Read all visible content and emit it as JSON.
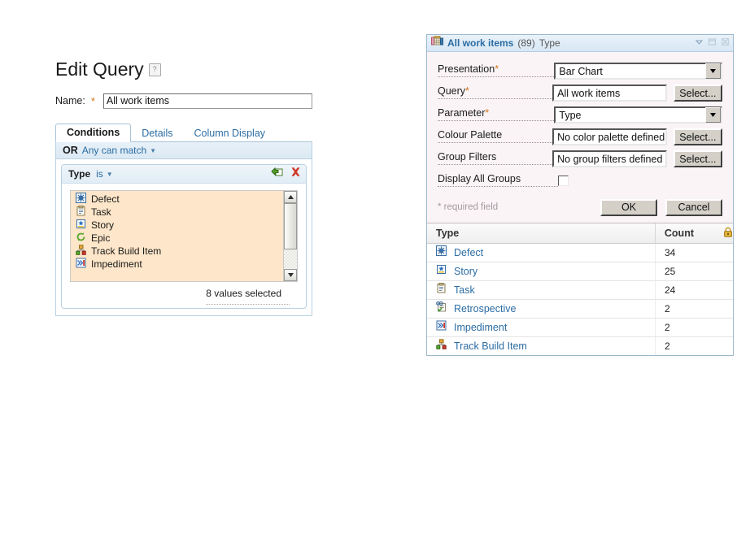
{
  "edit_query": {
    "title": "Edit Query",
    "help_icon": "help-icon",
    "name_label": "Name:",
    "required_mark": "*",
    "name_value": "All work items",
    "name_placeholder": "",
    "tabs": [
      {
        "label": "Conditions",
        "active": true
      },
      {
        "label": "Details",
        "active": false
      },
      {
        "label": "Column Display",
        "active": false
      }
    ],
    "match_bar": {
      "operator": "OR",
      "text": "Any can match"
    },
    "condition": {
      "field": "Type",
      "operator": "is",
      "copy_icon": "copy-condition-icon",
      "delete_icon": "delete-condition-icon",
      "values": [
        {
          "label": "Defect",
          "icon": "defect-icon"
        },
        {
          "label": "Task",
          "icon": "task-icon"
        },
        {
          "label": "Story",
          "icon": "story-icon"
        },
        {
          "label": "Epic",
          "icon": "epic-icon"
        },
        {
          "label": "Track Build Item",
          "icon": "track-build-item-icon"
        },
        {
          "label": "Impediment",
          "icon": "impediment-icon"
        }
      ],
      "selected_note": "8 values selected"
    }
  },
  "dialog": {
    "icon": "bar-chart-report-icon",
    "title": "All work items",
    "count_label": "(89)",
    "param_label": "Type",
    "controls": {
      "collapse": "chevron-down-icon",
      "restore": "restore-icon",
      "maximize": "maximize-icon"
    },
    "fields": {
      "presentation": {
        "label": "Presentation",
        "required": "*",
        "value": "Bar Chart"
      },
      "query": {
        "label": "Query",
        "required": "*",
        "value": "All work items",
        "button": "Select..."
      },
      "parameter": {
        "label": "Parameter",
        "required": "*",
        "value": "Type"
      },
      "colour_palette": {
        "label": "Colour Palette",
        "required": "",
        "value": "No color palette defined",
        "button": "Select..."
      },
      "group_filters": {
        "label": "Group Filters",
        "required": "",
        "value": "No group filters defined",
        "button": "Select..."
      },
      "display_all_groups": {
        "label": "Display All Groups",
        "required": "",
        "checked": false
      }
    },
    "required_note": "* required field",
    "ok_label": "OK",
    "cancel_label": "Cancel",
    "results": {
      "columns": [
        "Type",
        "Count"
      ],
      "lock_icon": "lock-icon",
      "rows": [
        {
          "type": "Defect",
          "icon": "defect-icon",
          "count": "34"
        },
        {
          "type": "Story",
          "icon": "story-icon",
          "count": "25"
        },
        {
          "type": "Task",
          "icon": "task-icon",
          "count": "24"
        },
        {
          "type": "Retrospective",
          "icon": "retrospective-icon",
          "count": "2"
        },
        {
          "type": "Impediment",
          "icon": "impediment-icon",
          "count": "2"
        },
        {
          "type": "Track Build Item",
          "icon": "track-build-item-icon",
          "count": "2"
        }
      ]
    }
  },
  "chart_data": {
    "type": "bar",
    "title": "All work items (89) Type",
    "categories": [
      "Defect",
      "Story",
      "Task",
      "Retrospective",
      "Impediment",
      "Track Build Item"
    ],
    "values": [
      34,
      25,
      24,
      2,
      2,
      2
    ],
    "xlabel": "Type",
    "ylabel": "Count",
    "total": 89,
    "legend": "none",
    "grid": false
  }
}
